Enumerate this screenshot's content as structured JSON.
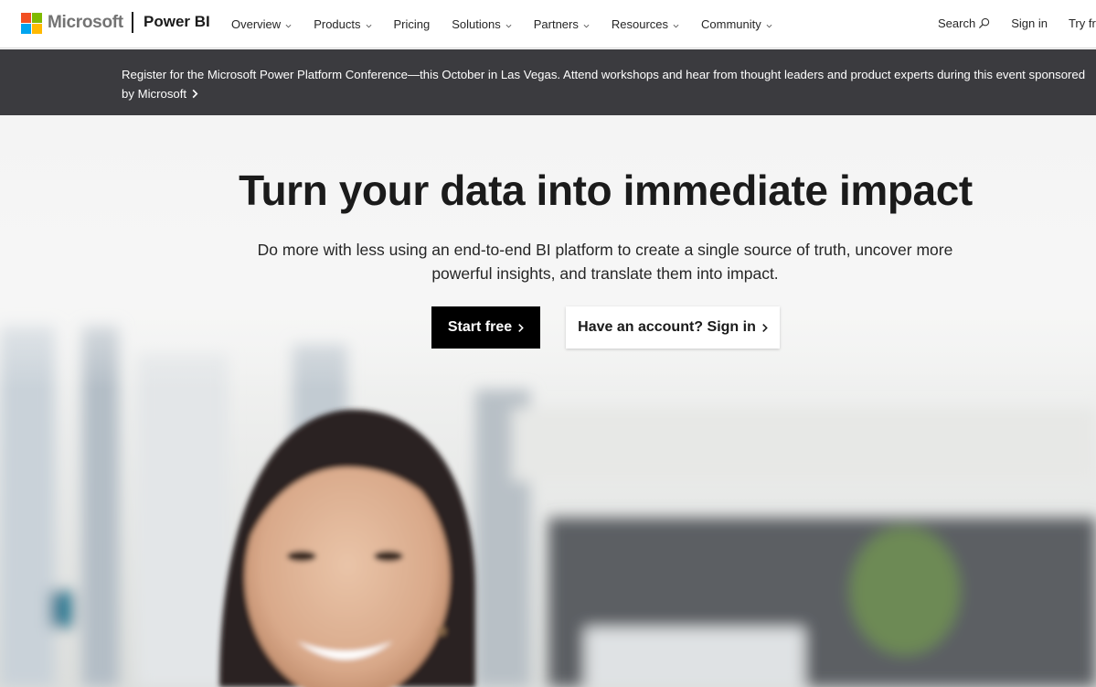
{
  "header": {
    "brand": "Microsoft",
    "product": "Power BI",
    "nav_items": [
      {
        "label": "Overview",
        "dropdown": true
      },
      {
        "label": "Products",
        "dropdown": true
      },
      {
        "label": "Pricing",
        "dropdown": false
      },
      {
        "label": "Solutions",
        "dropdown": true
      },
      {
        "label": "Partners",
        "dropdown": true
      },
      {
        "label": "Resources",
        "dropdown": true
      },
      {
        "label": "Community",
        "dropdown": true
      }
    ],
    "search_label": "Search",
    "signin_label": "Sign in",
    "try_label": "Try fr"
  },
  "banner": {
    "text": "Register for the Microsoft Power Platform Conference—this October in Las Vegas. Attend workshops and hear from thought leaders and product experts during this event sponsored by Microsoft"
  },
  "hero": {
    "title": "Turn your data into immediate impact",
    "subtitle": "Do more with less using an end-to-end BI platform to create a single source of truth, uncover more powerful insights, and translate them into impact.",
    "primary_button": "Start free",
    "secondary_button": "Have an account? Sign in"
  },
  "colors": {
    "ms_red": "#f25022",
    "ms_green": "#7fba00",
    "ms_blue": "#00a4ef",
    "ms_yellow": "#ffb900",
    "banner_bg": "#3b3b3f",
    "primary_btn_bg": "#000000"
  },
  "icons": {
    "logo": "microsoft-logo-icon",
    "nav_dropdown": "chevron-down-icon",
    "search": "search-icon",
    "banner_link": "chevron-right-icon",
    "button_arrow": "chevron-right-icon"
  }
}
